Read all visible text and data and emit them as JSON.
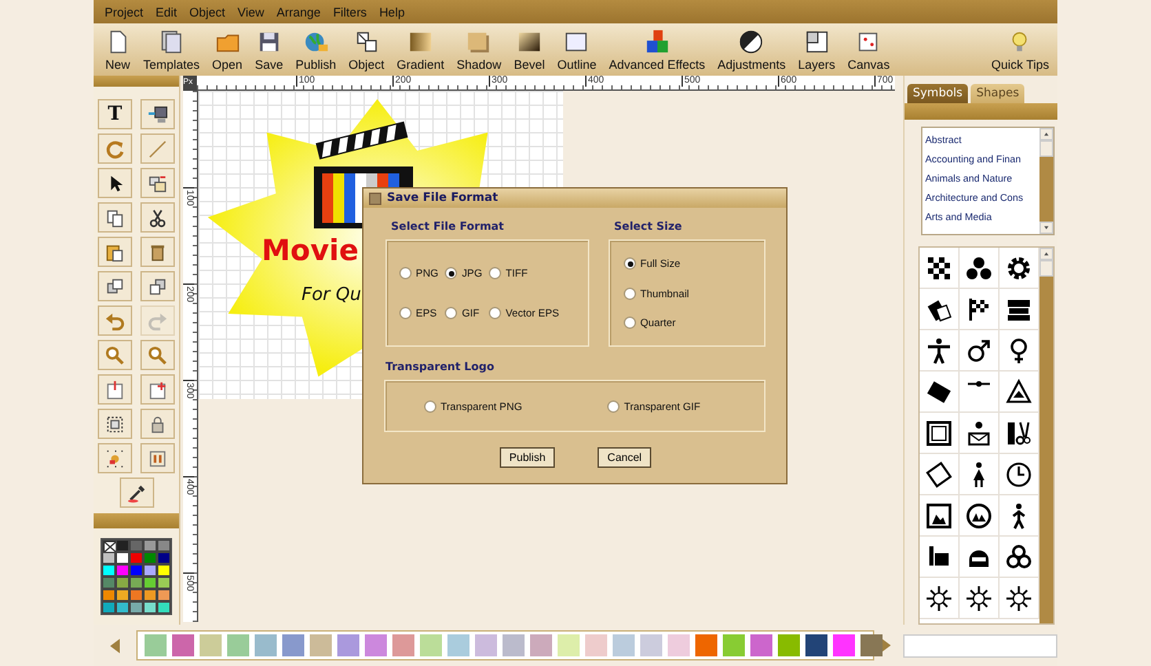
{
  "menu": [
    "Project",
    "Edit",
    "Object",
    "View",
    "Arrange",
    "Filters",
    "Help"
  ],
  "toolbar": [
    {
      "label": "New",
      "kind": "new"
    },
    {
      "label": "Templates",
      "kind": "templates"
    },
    {
      "label": "Open",
      "kind": "open"
    },
    {
      "label": "Save",
      "kind": "save"
    },
    {
      "label": "Publish",
      "kind": "publish"
    },
    {
      "label": "Object",
      "kind": "object"
    },
    {
      "label": "Gradient",
      "kind": "gradient"
    },
    {
      "label": "Shadow",
      "kind": "shadow"
    },
    {
      "label": "Bevel",
      "kind": "bevel"
    },
    {
      "label": "Outline",
      "kind": "outline"
    },
    {
      "label": "Advanced Effects",
      "kind": "effects"
    },
    {
      "label": "Adjustments",
      "kind": "adjustments"
    },
    {
      "label": "Layers",
      "kind": "layers"
    },
    {
      "label": "Canvas",
      "kind": "canvas"
    },
    {
      "label": "Quick Tips",
      "kind": "tips"
    }
  ],
  "tools": [
    {
      "kind": "text",
      "glyph": "T",
      "disabled": false
    },
    {
      "kind": "import",
      "disabled": false
    },
    {
      "kind": "rotate",
      "disabled": false
    },
    {
      "kind": "line",
      "disabled": false
    },
    {
      "kind": "pointer",
      "disabled": false
    },
    {
      "kind": "arrange",
      "disabled": false
    },
    {
      "kind": "copy",
      "disabled": false
    },
    {
      "kind": "cut",
      "disabled": false
    },
    {
      "kind": "paste",
      "disabled": false
    },
    {
      "kind": "delete",
      "disabled": false
    },
    {
      "kind": "front",
      "disabled": false
    },
    {
      "kind": "back",
      "disabled": false
    },
    {
      "kind": "undo",
      "disabled": false
    },
    {
      "kind": "redo",
      "disabled": true
    },
    {
      "kind": "zoomin",
      "disabled": false
    },
    {
      "kind": "zoomout",
      "disabled": false
    },
    {
      "kind": "flip",
      "disabled": false
    },
    {
      "kind": "frame",
      "disabled": false
    },
    {
      "kind": "group",
      "disabled": false
    },
    {
      "kind": "lock",
      "disabled": false
    },
    {
      "kind": "scatter",
      "disabled": false
    },
    {
      "kind": "align",
      "disabled": false
    },
    {
      "kind": "eyedropper",
      "disabled": false
    }
  ],
  "palette": [
    {
      "kind": "none"
    },
    {
      "kind": "color",
      "color": "#222222"
    },
    {
      "kind": "color",
      "color": "#666666"
    },
    {
      "kind": "color",
      "color": "#999999"
    },
    {
      "kind": "color",
      "color": "#888888"
    },
    {
      "kind": "color",
      "color": "#c0c0c0"
    },
    {
      "kind": "color",
      "color": "#ffffff"
    },
    {
      "kind": "color",
      "color": "#ee0000"
    },
    {
      "kind": "color",
      "color": "#008800"
    },
    {
      "kind": "color",
      "color": "#000088"
    },
    {
      "kind": "color",
      "color": "#00ffff"
    },
    {
      "kind": "color",
      "color": "#ff00ff"
    },
    {
      "kind": "color",
      "color": "#0000ff"
    },
    {
      "kind": "color",
      "color": "#aaaaff"
    },
    {
      "kind": "color",
      "color": "#ffff00"
    },
    {
      "kind": "color",
      "color": "#558866"
    },
    {
      "kind": "color",
      "color": "#88aa44"
    },
    {
      "kind": "color",
      "color": "#77aa55"
    },
    {
      "kind": "color",
      "color": "#66cc33"
    },
    {
      "kind": "color",
      "color": "#99cc55"
    },
    {
      "kind": "color",
      "color": "#ee8800"
    },
    {
      "kind": "color",
      "color": "#eeaa22"
    },
    {
      "kind": "color",
      "color": "#ee7722"
    },
    {
      "kind": "color",
      "color": "#ee9922"
    },
    {
      "kind": "color",
      "color": "#ee9955"
    },
    {
      "kind": "color",
      "color": "#11aabb"
    },
    {
      "kind": "color",
      "color": "#33bbcc"
    },
    {
      "kind": "color",
      "color": "#77aaaa"
    },
    {
      "kind": "color",
      "color": "#77ddcc"
    },
    {
      "kind": "color",
      "color": "#33ddbb"
    }
  ],
  "canvas": {
    "corner": "Px",
    "top_ruler": [
      "100",
      "200",
      "300",
      "400",
      "500",
      "600",
      "700"
    ],
    "left_ruler": [
      "100",
      "200",
      "300",
      "400",
      "500"
    ],
    "logo_title": "Movie",
    "logo_tagline": "For Qu"
  },
  "dialog": {
    "title": "Save File Format",
    "format_heading": "Select File Format",
    "formats": [
      {
        "label": "PNG",
        "selected": false
      },
      {
        "label": "JPG",
        "selected": true
      },
      {
        "label": "TIFF",
        "selected": false
      },
      {
        "label": "EPS",
        "selected": false
      },
      {
        "label": "GIF",
        "selected": false
      },
      {
        "label": "Vector EPS",
        "selected": false
      }
    ],
    "size_heading": "Select Size",
    "sizes": [
      {
        "label": "Full Size",
        "selected": true
      },
      {
        "label": "Thumbnail",
        "selected": false
      },
      {
        "label": "Quarter",
        "selected": false
      }
    ],
    "transparent_heading": "Transparent Logo",
    "transparent": [
      {
        "label": "Transparent PNG",
        "selected": false
      },
      {
        "label": "Transparent GIF",
        "selected": false
      }
    ],
    "buttons": [
      "Publish",
      "Cancel"
    ]
  },
  "right_panel": {
    "tabs": [
      {
        "label": "Symbols",
        "selected": true
      },
      {
        "label": "Shapes",
        "selected": false
      }
    ],
    "categories": [
      "Abstract",
      "Accounting and Finan",
      "Animals and Nature",
      "Architecture and Cons",
      "Arts and Media"
    ]
  },
  "gradients": [
    {
      "color": "#99cc99"
    },
    {
      "color": "#cc66aa"
    },
    {
      "color": "#cccc99"
    },
    {
      "color": "#99cc99"
    },
    {
      "color": "#99bbcc"
    },
    {
      "color": "#8899cc"
    },
    {
      "color": "#ccbb99"
    },
    {
      "color": "#aa99dd"
    },
    {
      "color": "#cc88dd"
    },
    {
      "color": "#dd9999"
    },
    {
      "color": "#bbdd99"
    },
    {
      "color": "#aaccdd"
    },
    {
      "color": "#ccbbdd"
    },
    {
      "color": "#bbbbcc"
    },
    {
      "color": "#ccaabb"
    },
    {
      "color": "#ddeeaa"
    },
    {
      "color": "#eecccc"
    },
    {
      "color": "#bbccdd"
    },
    {
      "color": "#ccccdd"
    },
    {
      "color": "#eeccdd"
    },
    {
      "color": "#ee6600"
    },
    {
      "color": "#88cc33"
    },
    {
      "color": "#cc66cc"
    },
    {
      "color": "#88bb00"
    },
    {
      "color": "#224477"
    },
    {
      "color": "#ff33ff"
    },
    {
      "color": "#887755"
    }
  ]
}
